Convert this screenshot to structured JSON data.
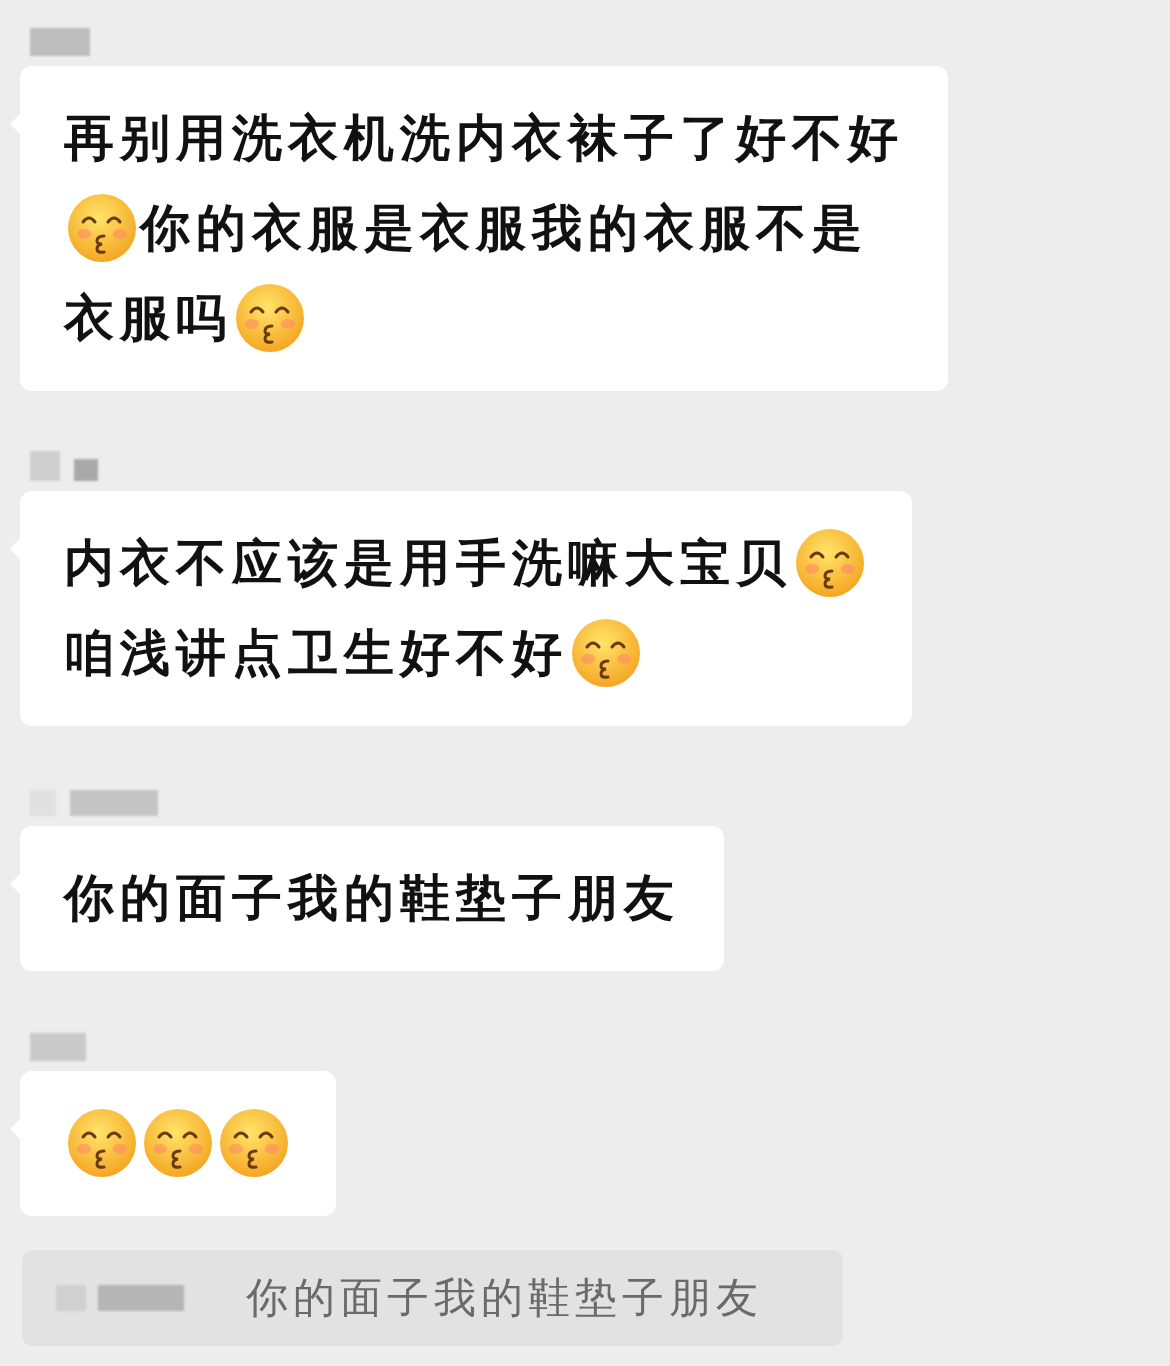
{
  "messages": [
    {
      "lines": [
        [
          {
            "kind": "text",
            "text": "再别用洗衣机洗内衣袜子了好不好"
          }
        ],
        [
          {
            "kind": "emoji"
          },
          {
            "kind": "text",
            "text": "你的衣服是衣服我的衣服不是"
          }
        ],
        [
          {
            "kind": "text",
            "text": "衣服吗"
          },
          {
            "kind": "emoji"
          }
        ]
      ]
    },
    {
      "lines": [
        [
          {
            "kind": "text",
            "text": "内衣不应该是用手洗嘛大宝贝"
          },
          {
            "kind": "emoji"
          }
        ],
        [
          {
            "kind": "text",
            "text": "咱浅讲点卫生好不好"
          },
          {
            "kind": "emoji"
          }
        ]
      ]
    },
    {
      "lines": [
        [
          {
            "kind": "text",
            "text": "你的面子我的鞋垫子朋友"
          }
        ]
      ]
    },
    {
      "lines": [
        [
          {
            "kind": "emoji"
          },
          {
            "kind": "emoji"
          },
          {
            "kind": "emoji"
          }
        ]
      ]
    }
  ],
  "quote": {
    "text": "你的面子我的鞋垫子朋友"
  }
}
